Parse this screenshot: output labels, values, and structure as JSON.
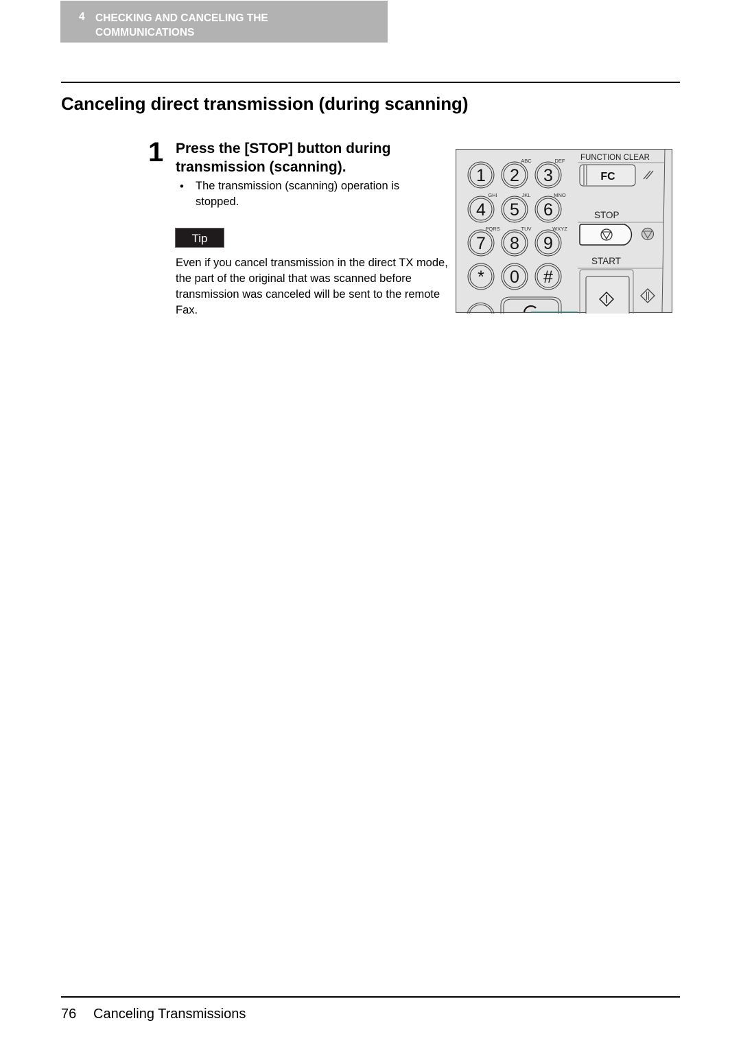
{
  "header": {
    "chapter_number": "4",
    "chapter_title": "CHECKING AND CANCELING THE COMMUNICATIONS"
  },
  "section": {
    "title": "Canceling direct transmission (during scanning)"
  },
  "steps": [
    {
      "number": "1",
      "title": "Press the [STOP] button during transmission (scanning).",
      "bullets": [
        "The transmission (scanning) operation is stopped."
      ]
    }
  ],
  "tip": {
    "label": "Tip",
    "text": "Even if you cancel transmission in the direct TX mode, the part of the original that was scanned before transmission was canceled will be sent to the remote Fax."
  },
  "control_panel": {
    "keys": [
      {
        "digit": "1",
        "letters": ""
      },
      {
        "digit": "2",
        "letters": "ABC"
      },
      {
        "digit": "3",
        "letters": "DEF"
      },
      {
        "digit": "4",
        "letters": "GHI"
      },
      {
        "digit": "5",
        "letters": "JKL"
      },
      {
        "digit": "6",
        "letters": "MNO"
      },
      {
        "digit": "7",
        "letters": "PQRS"
      },
      {
        "digit": "8",
        "letters": "TUV"
      },
      {
        "digit": "9",
        "letters": "WXYZ"
      },
      {
        "digit": "*",
        "letters": ""
      },
      {
        "digit": "0",
        "letters": ""
      },
      {
        "digit": "#",
        "letters": ""
      }
    ],
    "function_clear_label": "FUNCTION CLEAR",
    "fc_button_label": "FC",
    "stop_label": "STOP",
    "start_label": "START",
    "clear_key_label": "C",
    "panel_bg": "#e4e4e4"
  },
  "footer": {
    "page_number": "76",
    "title": "Canceling Transmissions"
  }
}
